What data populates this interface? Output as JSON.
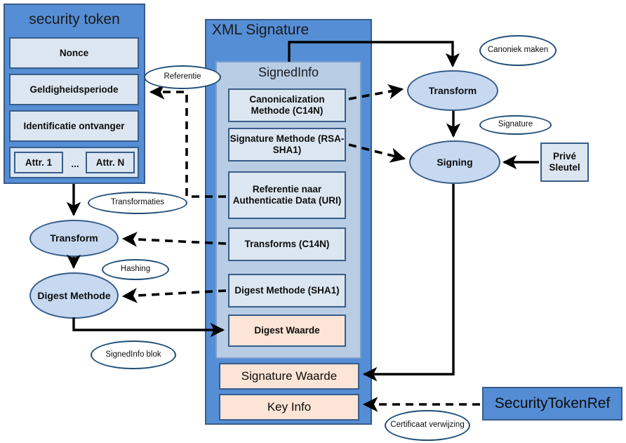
{
  "diagram": {
    "title_security_token": "security token",
    "title_xml_signature": "XML Signature",
    "title_signedinfo": "SignedInfo"
  },
  "security_token": {
    "fields": [
      {
        "label": "Nonce"
      },
      {
        "label": "Geldigheidsperiode"
      },
      {
        "label": "Identificatie ontvanger"
      }
    ],
    "attributes": {
      "first": "Attr. 1",
      "ellipsis": "...",
      "last": "Attr. N"
    }
  },
  "signed_info": {
    "items": [
      {
        "label": "Canonicalization Methode (C14N)"
      },
      {
        "label": "Signature Methode (RSA-SHA1)"
      },
      {
        "label": "Referentie naar Authenticatie Data (URI)"
      },
      {
        "label": "Transforms (C14N)"
      },
      {
        "label": "Digest Methode (SHA1)"
      }
    ],
    "digest_value": "Digest Waarde"
  },
  "xml_signature": {
    "signature_value": "Signature Waarde",
    "key_info": "Key Info"
  },
  "processes": {
    "left_transform": "Transform",
    "left_digest": "Digest Methode",
    "right_transform": "Transform",
    "right_signing": "Signing"
  },
  "external": {
    "private_key": "Privé Sleutel",
    "security_token_ref": "SecurityTokenRef"
  },
  "annotations": {
    "referentie": "Referentie",
    "transformaties": "Transformaties",
    "hashing": "Hashing",
    "signedinfo_blok": "SignedInfo blok",
    "canoniek_maken": "Canoniek maken",
    "signature": "Signature",
    "certificaat_verwijzing": "Certificaat verwijzing"
  },
  "colors": {
    "shell_blue": "#558ED5",
    "panel_blue": "#B8CCE4",
    "item_blue": "#DCE6F1",
    "value_peach": "#FCE4D6",
    "process_blue": "#C6D9F1",
    "border_dark": "#385D8A",
    "note_border": "#1F4E79"
  }
}
